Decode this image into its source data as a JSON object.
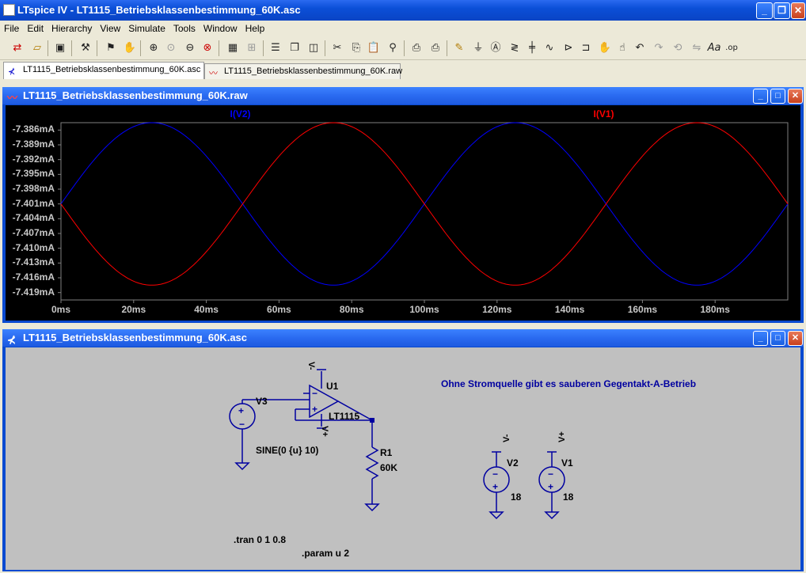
{
  "app": {
    "title": "LTspice IV - LT1115_Betriebsklassenbestimmung_60K.asc"
  },
  "menu": [
    "File",
    "Edit",
    "Hierarchy",
    "View",
    "Simulate",
    "Tools",
    "Window",
    "Help"
  ],
  "toolbar": {
    "icons": [
      "new-schematic-icon",
      "open-icon",
      "save-icon",
      "control-panel-icon",
      "run-icon",
      "halt-icon",
      "zoom-in-icon",
      "pan-icon",
      "zoom-out-icon",
      "zoom-fit-icon",
      "autorange-icon",
      "grid-icon",
      "tile-horizontal-icon",
      "cascade-icon",
      "tile-vertical-icon",
      "cut-icon",
      "copy-icon",
      "paste-icon",
      "find-icon",
      "print-preview-icon",
      "print-icon",
      "draw-wire-icon",
      "ground-icon",
      "label-net-icon",
      "resistor-icon",
      "capacitor-icon",
      "inductor-icon",
      "diode-icon",
      "component-icon",
      "move-icon",
      "drag-icon",
      "undo-icon",
      "redo-icon",
      "rotate-icon",
      "mirror-icon",
      "text-icon",
      "spice-directive-icon"
    ]
  },
  "tabs": [
    {
      "label": "LT1115_Betriebsklassenbestimmung_60K.asc",
      "active": true
    },
    {
      "label": "LT1115_Betriebsklassenbestimmung_60K.raw",
      "active": false
    }
  ],
  "waveform_window": {
    "title": "LT1115_Betriebsklassenbestimmung_60K.raw"
  },
  "schematic_window": {
    "title": "LT1115_Betriebsklassenbestimmung_60K.asc"
  },
  "chart_data": {
    "type": "line",
    "xlabel": "",
    "ylabel": "",
    "x_ticks": [
      "0ms",
      "20ms",
      "40ms",
      "60ms",
      "80ms",
      "100ms",
      "120ms",
      "140ms",
      "160ms",
      "180ms"
    ],
    "y_ticks": [
      "-7.386mA",
      "-7.389mA",
      "-7.392mA",
      "-7.395mA",
      "-7.398mA",
      "-7.401mA",
      "-7.404mA",
      "-7.407mA",
      "-7.410mA",
      "-7.413mA",
      "-7.416mA",
      "-7.419mA"
    ],
    "xlim": [
      0,
      200
    ],
    "ylim": [
      -7.4205,
      -7.3845
    ],
    "series": [
      {
        "name": "I(V2)",
        "color": "#0000ff",
        "function": "sine",
        "offset": -7.401,
        "amplitude": 0.0165,
        "frequency_hz": 10,
        "phase_deg": 0
      },
      {
        "name": "I(V1)",
        "color": "#ff0000",
        "function": "sine",
        "offset": -7.401,
        "amplitude": 0.0165,
        "frequency_hz": 10,
        "phase_deg": 180
      }
    ],
    "background": "#000000"
  },
  "schematic": {
    "labels": {
      "v3": "V3",
      "v3_value": "SINE(0 {u} 10)",
      "u1": "U1",
      "u1_part": "LT1115",
      "r1": "R1",
      "r1_value": "60K",
      "v2": "V2",
      "v2_value": "18",
      "v1": "V1",
      "v1_value": "18",
      "flag_minus": "V-",
      "flag_plus": "V+",
      "flag_plus2": "V+",
      "flag_minus2": "V-"
    },
    "comment": "Ohne Stromquelle gibt es sauberen Gegentakt-A-Betrieb",
    "directives": {
      "tran": ".tran 0 1 0.8",
      "param": ".param u 2"
    }
  }
}
